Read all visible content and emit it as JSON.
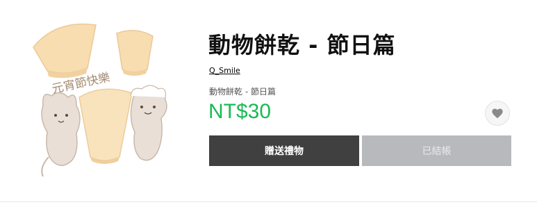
{
  "product": {
    "title": "動物餅乾 - 節日篇",
    "author": "Q_Smile",
    "subtitle": "動物餅乾 - 節日篇",
    "price": "NT$30",
    "price_color": "#19b955"
  },
  "buttons": {
    "gift_label": "贈送禮物",
    "owned_label": "已結帳"
  },
  "hero_image": {
    "text": "元宵節快樂"
  },
  "icons": {
    "wishlist": "heart-icon"
  }
}
